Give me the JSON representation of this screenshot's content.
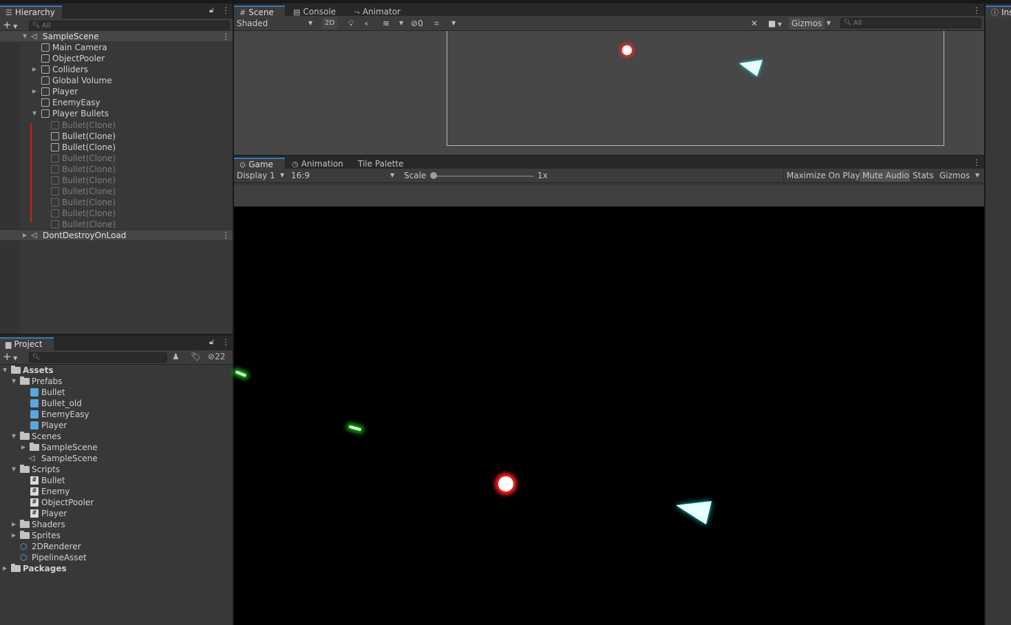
{
  "hierarchy": {
    "tab_label": "Hierarchy",
    "search_placeholder": "All",
    "scene_name": "SampleScene",
    "items": [
      {
        "label": "Main Camera"
      },
      {
        "label": "ObjectPooler"
      },
      {
        "label": "Colliders"
      },
      {
        "label": "Global Volume"
      },
      {
        "label": "Player"
      },
      {
        "label": "EnemyEasy"
      },
      {
        "label": "Player Bullets"
      },
      {
        "label": "Bullet(Clone)"
      },
      {
        "label": "Bullet(Clone)"
      },
      {
        "label": "Bullet(Clone)"
      },
      {
        "label": "Bullet(Clone)"
      },
      {
        "label": "Bullet(Clone)"
      },
      {
        "label": "Bullet(Clone)"
      },
      {
        "label": "Bullet(Clone)"
      },
      {
        "label": "Bullet(Clone)"
      },
      {
        "label": "Bullet(Clone)"
      },
      {
        "label": "Bullet(Clone)"
      }
    ],
    "dontdestroy_label": "DontDestroyOnLoad"
  },
  "scene": {
    "tabs": [
      "Scene",
      "Console",
      "Animator"
    ],
    "shading_mode": "Shaded",
    "toggle_2d": "2D",
    "hidden_count": "0",
    "gizmos_label": "Gizmos",
    "search_placeholder": "All"
  },
  "game": {
    "tabs": [
      "Game",
      "Animation",
      "Tile Palette"
    ],
    "display": "Display 1",
    "aspect": "16:9",
    "scale_label": "Scale",
    "scale_value": "1x",
    "maximize": "Maximize On Play",
    "mute": "Mute Audio",
    "stats": "Stats",
    "gizmos": "Gizmos"
  },
  "project": {
    "tab_label": "Project",
    "hidden_count": "22",
    "tree": {
      "assets": "Assets",
      "prefabs": "Prefabs",
      "prefab_items": [
        "Bullet",
        "Bullet_old",
        "EnemyEasy",
        "Player"
      ],
      "scenes": "Scenes",
      "scene_folder": "SampleScene",
      "scene_asset": "SampleScene",
      "scripts": "Scripts",
      "script_items": [
        "Bullet",
        "Enemy",
        "ObjectPooler",
        "Player"
      ],
      "shaders": "Shaders",
      "sprites": "Sprites",
      "renderer": "2DRenderer",
      "pipeline": "PipelineAsset",
      "packages": "Packages"
    }
  },
  "inspector": {
    "tab_label": "Ins"
  }
}
